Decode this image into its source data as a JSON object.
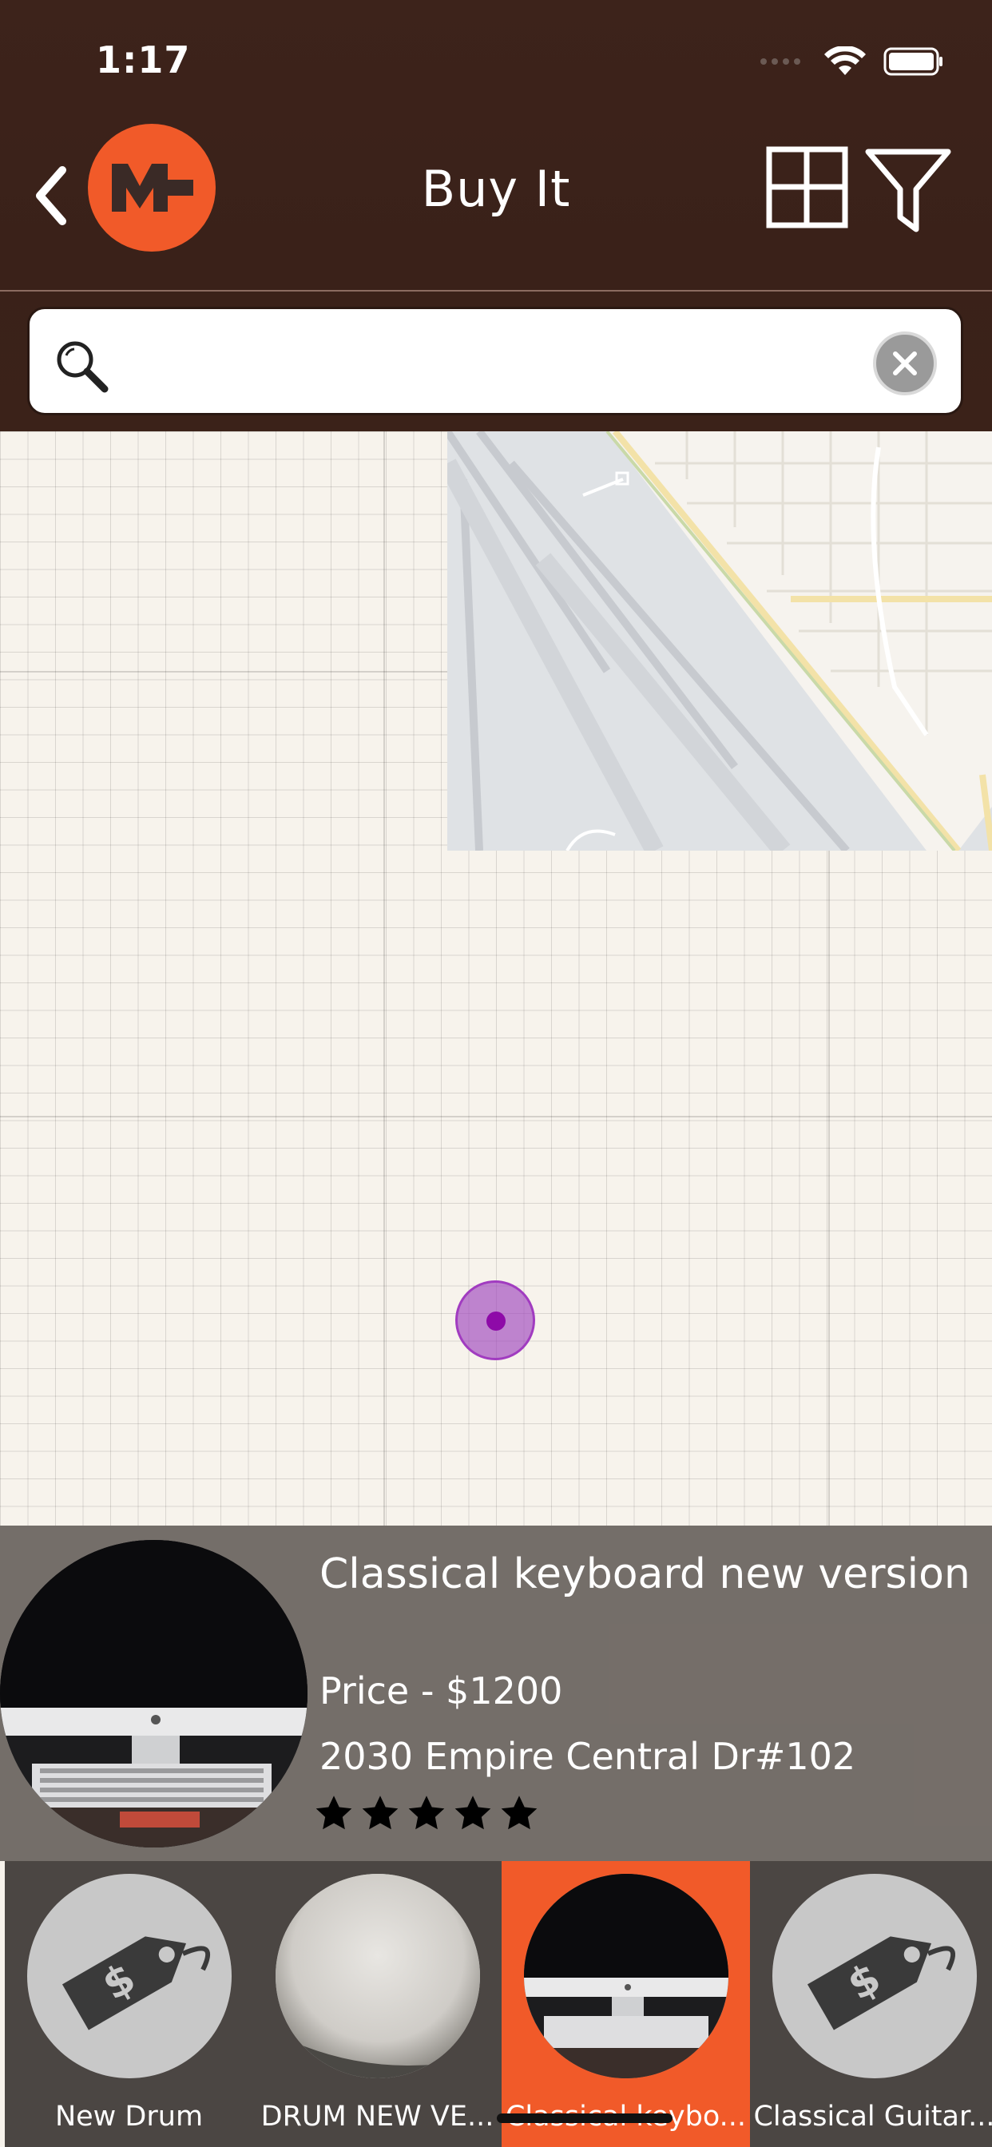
{
  "status_bar": {
    "time": "1:17",
    "icons": [
      "signal-icon",
      "wifi-icon",
      "battery-icon"
    ]
  },
  "nav": {
    "title": "Buy It",
    "back_icon": "chevron-left-icon",
    "logo_text": "M",
    "grid_icon": "grid-view-icon",
    "filter_icon": "filter-icon"
  },
  "search": {
    "value": "",
    "placeholder": "",
    "icon": "search-icon",
    "clear_icon": "clear-icon"
  },
  "map": {
    "pin_color": "#a13cc0"
  },
  "selected_listing": {
    "name": "Classical keyboard new version",
    "price": "Price  - $1200",
    "address": "2030 Empire Central Dr#102",
    "rating": 5
  },
  "listings": [
    {
      "label": "New Drum",
      "image": "price-tag-icon",
      "selected": false
    },
    {
      "label": "DRUM NEW VE...",
      "image": "photo",
      "selected": false
    },
    {
      "label": "Classical keybo...",
      "image": "photo",
      "selected": true
    },
    {
      "label": "Classical Guitar...",
      "image": "price-tag-icon",
      "selected": false
    }
  ],
  "colors": {
    "brand": "#f15a29",
    "header": "#3d231b"
  }
}
